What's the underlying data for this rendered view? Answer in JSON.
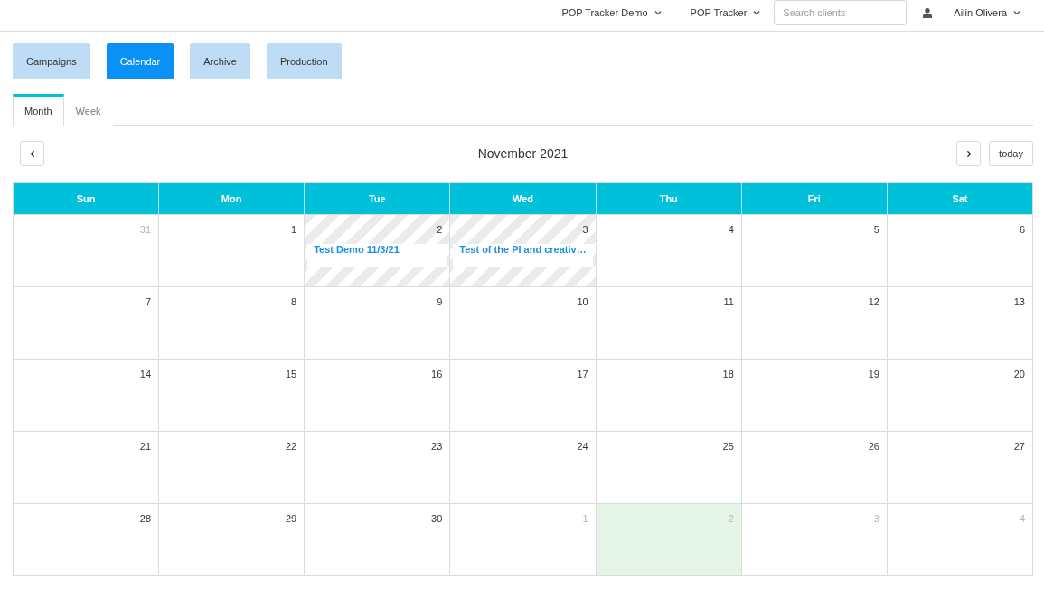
{
  "top_bar": {
    "menus": [
      {
        "label": "POP Tracker Demo"
      },
      {
        "label": "POP Tracker"
      }
    ],
    "search": {
      "placeholder": "Search clients"
    },
    "user": {
      "name": "Ailin Olivera"
    }
  },
  "nav_buttons": [
    {
      "label": "Campaigns",
      "selected": false
    },
    {
      "label": "Calendar",
      "selected": true
    },
    {
      "label": "Archive",
      "selected": false
    },
    {
      "label": "Production",
      "selected": false
    }
  ],
  "view_tabs": [
    {
      "label": "Month",
      "selected": true
    },
    {
      "label": "Week",
      "selected": false
    }
  ],
  "calendar": {
    "title": "November 2021",
    "today_button": "today",
    "weekdays": [
      "Sun",
      "Mon",
      "Tue",
      "Wed",
      "Thu",
      "Fri",
      "Sat"
    ],
    "weeks": [
      [
        {
          "day": "31",
          "other_month": true,
          "today": false,
          "striped": false
        },
        {
          "day": "1",
          "other_month": false,
          "today": false,
          "striped": false
        },
        {
          "day": "2",
          "other_month": false,
          "today": false,
          "striped": true,
          "events": [
            {
              "title": "Test Demo 11/3/21"
            }
          ]
        },
        {
          "day": "3",
          "other_month": false,
          "today": false,
          "striped": true,
          "events": [
            {
              "title": "Test of the PI and creativ…"
            }
          ]
        },
        {
          "day": "4",
          "other_month": false,
          "today": false,
          "striped": false
        },
        {
          "day": "5",
          "other_month": false,
          "today": false,
          "striped": false
        },
        {
          "day": "6",
          "other_month": false,
          "today": false,
          "striped": false
        }
      ],
      [
        {
          "day": "7",
          "other_month": false,
          "today": false,
          "striped": false
        },
        {
          "day": "8",
          "other_month": false,
          "today": false,
          "striped": false
        },
        {
          "day": "9",
          "other_month": false,
          "today": false,
          "striped": false
        },
        {
          "day": "10",
          "other_month": false,
          "today": false,
          "striped": false
        },
        {
          "day": "11",
          "other_month": false,
          "today": false,
          "striped": false
        },
        {
          "day": "12",
          "other_month": false,
          "today": false,
          "striped": false
        },
        {
          "day": "13",
          "other_month": false,
          "today": false,
          "striped": false
        }
      ],
      [
        {
          "day": "14",
          "other_month": false,
          "today": false,
          "striped": false
        },
        {
          "day": "15",
          "other_month": false,
          "today": false,
          "striped": false
        },
        {
          "day": "16",
          "other_month": false,
          "today": false,
          "striped": false
        },
        {
          "day": "17",
          "other_month": false,
          "today": false,
          "striped": false
        },
        {
          "day": "18",
          "other_month": false,
          "today": false,
          "striped": false
        },
        {
          "day": "19",
          "other_month": false,
          "today": false,
          "striped": false
        },
        {
          "day": "20",
          "other_month": false,
          "today": false,
          "striped": false
        }
      ],
      [
        {
          "day": "21",
          "other_month": false,
          "today": false,
          "striped": false
        },
        {
          "day": "22",
          "other_month": false,
          "today": false,
          "striped": false
        },
        {
          "day": "23",
          "other_month": false,
          "today": false,
          "striped": false
        },
        {
          "day": "24",
          "other_month": false,
          "today": false,
          "striped": false
        },
        {
          "day": "25",
          "other_month": false,
          "today": false,
          "striped": false
        },
        {
          "day": "26",
          "other_month": false,
          "today": false,
          "striped": false
        },
        {
          "day": "27",
          "other_month": false,
          "today": false,
          "striped": false
        }
      ],
      [
        {
          "day": "28",
          "other_month": false,
          "today": false,
          "striped": false
        },
        {
          "day": "29",
          "other_month": false,
          "today": false,
          "striped": false
        },
        {
          "day": "30",
          "other_month": false,
          "today": false,
          "striped": false
        },
        {
          "day": "1",
          "other_month": true,
          "today": false,
          "striped": false
        },
        {
          "day": "2",
          "other_month": true,
          "today": true,
          "striped": false
        },
        {
          "day": "3",
          "other_month": true,
          "today": false,
          "striped": false
        },
        {
          "day": "4",
          "other_month": true,
          "today": false,
          "striped": false
        }
      ]
    ]
  }
}
